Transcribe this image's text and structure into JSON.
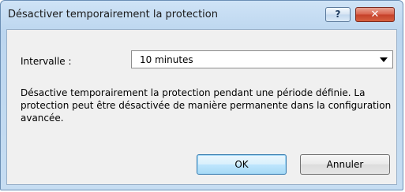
{
  "dialog": {
    "title": "Désactiver temporairement la protection",
    "help_label": "?",
    "close_label": "✕"
  },
  "interval": {
    "label": "Intervalle :",
    "selected_value": "10 minutes"
  },
  "description": "Désactive temporairement la protection pendant une période définie. La protection peut être désactivée de manière permanente dans la configuration avancée.",
  "buttons": {
    "ok_label": "OK",
    "cancel_label": "Annuler"
  },
  "colors": {
    "close_button": "#c4402a",
    "default_button_border": "#3c7fb1",
    "frame": "#bcd6ef"
  }
}
